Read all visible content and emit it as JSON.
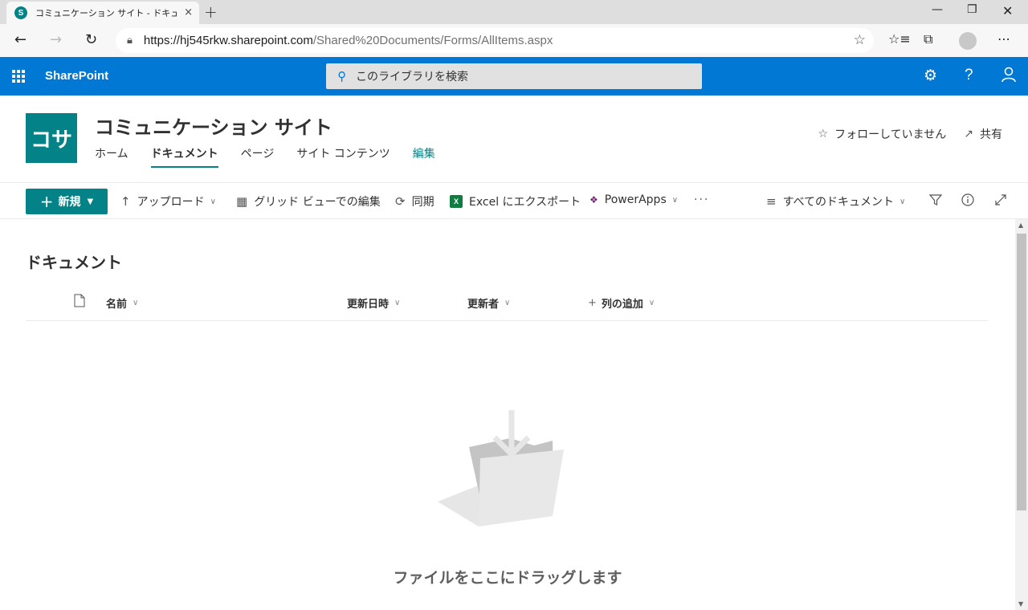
{
  "browser": {
    "tab_title": "コミュニケーション サイト - ドキュメント - すべて",
    "tab_close": "×",
    "new_tab": "+",
    "favicon_letter": "S",
    "url_host": "https://hj545rkw.sharepoint.com",
    "url_path": "/Shared%20Documents/Forms/AllItems.aspx"
  },
  "suite": {
    "brand": "SharePoint",
    "search_placeholder": "このライブラリを検索"
  },
  "site": {
    "logo_text": "コサ",
    "title": "コミュニケーション サイト",
    "nav": {
      "home": "ホーム",
      "documents": "ドキュメント",
      "pages": "ページ",
      "site_contents": "サイト コンテンツ",
      "edit": "編集"
    },
    "follow": "フォローしていません",
    "share": "共有"
  },
  "commands": {
    "new": "新規",
    "upload": "アップロード",
    "grid_edit": "グリッド ビューでの編集",
    "sync": "同期",
    "excel_export": "Excel にエクスポート",
    "excel_icon_letter": "X",
    "powerapps": "PowerApps",
    "more": "···",
    "view": "すべてのドキュメント"
  },
  "library": {
    "title": "ドキュメント",
    "columns": {
      "name": "名前",
      "modified": "更新日時",
      "modified_by": "更新者",
      "add_column": "列の追加"
    },
    "empty_message": "ファイルをここにドラッグします"
  },
  "colors": {
    "suite_bar": "#0078d4",
    "accent": "#038387",
    "excel": "#107c41"
  }
}
